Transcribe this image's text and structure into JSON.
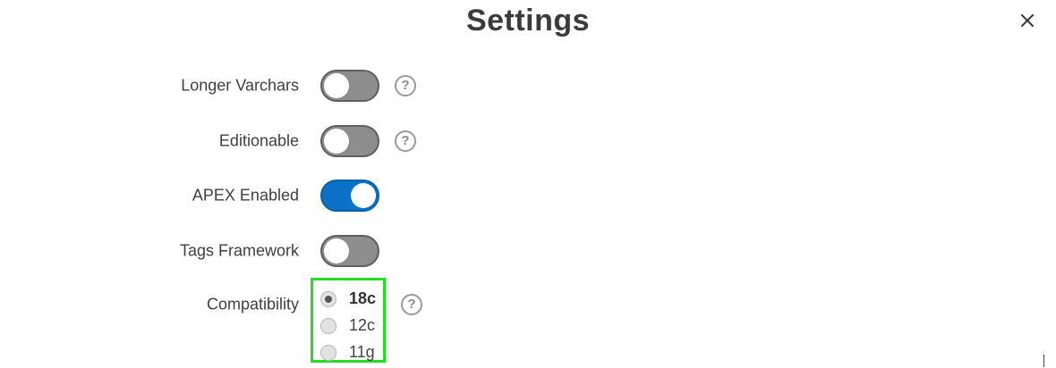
{
  "dialog": {
    "title": "Settings",
    "close_icon": "close-icon"
  },
  "settings": [
    {
      "label": "Longer Varchars",
      "enabled": false,
      "has_help": true
    },
    {
      "label": "Editionable",
      "enabled": false,
      "has_help": true
    },
    {
      "label": "APEX Enabled",
      "enabled": true,
      "has_help": false
    },
    {
      "label": "Tags Framework",
      "enabled": false,
      "has_help": false
    }
  ],
  "compatibility": {
    "label": "Compatibility",
    "selected": "18c",
    "options": [
      "18c",
      "12c",
      "11g"
    ],
    "highlight_color": "#22dd22"
  },
  "help": {
    "glyph": "?",
    "icon": "help-icon"
  },
  "colors": {
    "toggle_on": "#0a72c9",
    "toggle_off": "#8d8d8d"
  }
}
